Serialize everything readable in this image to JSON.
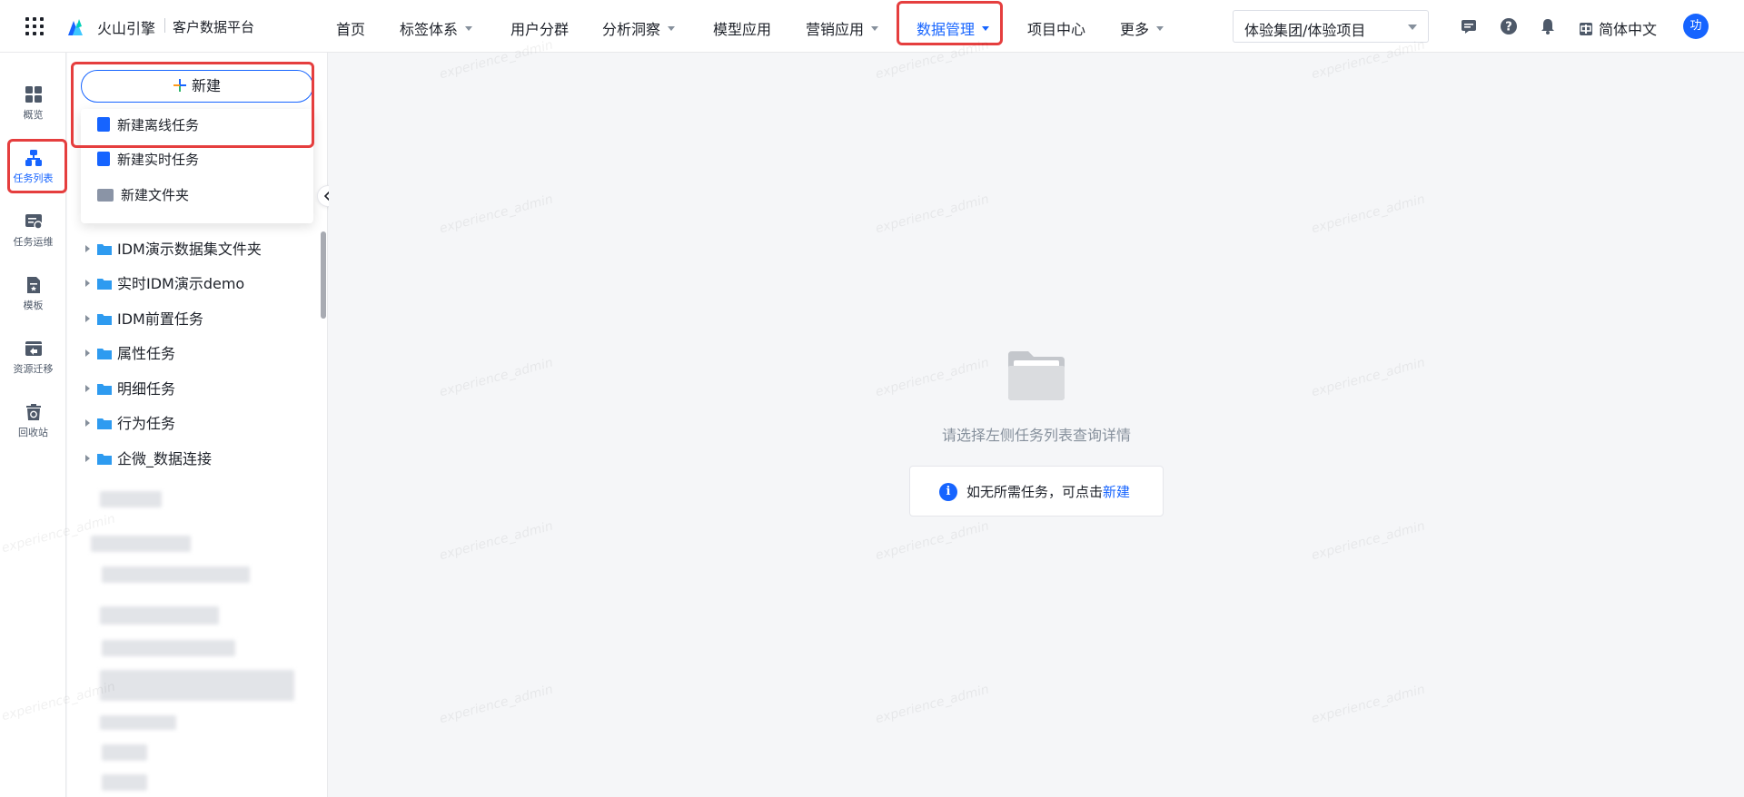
{
  "header": {
    "brand": "火山引擎",
    "platform": "客户数据平台",
    "nav": [
      {
        "label": "首页",
        "has_caret": false
      },
      {
        "label": "标签体系",
        "has_caret": true
      },
      {
        "label": "用户分群",
        "has_caret": false
      },
      {
        "label": "分析洞察",
        "has_caret": true
      },
      {
        "label": "模型应用",
        "has_caret": false
      },
      {
        "label": "营销应用",
        "has_caret": true
      },
      {
        "label": "数据管理",
        "has_caret": true,
        "active": true
      },
      {
        "label": "项目中心",
        "has_caret": false
      },
      {
        "label": "更多",
        "has_caret": true
      }
    ],
    "project_select": "体验集团/体验项目",
    "language": "简体中文",
    "avatar": "功",
    "icons": [
      "message-icon",
      "help-icon",
      "notification-icon",
      "language-icon"
    ]
  },
  "rail": {
    "items": [
      {
        "label": "概览",
        "icon": "overview-icon"
      },
      {
        "label": "任务列表",
        "icon": "task-list-icon",
        "active": true
      },
      {
        "label": "任务运维",
        "icon": "task-ops-icon"
      },
      {
        "label": "模板",
        "icon": "template-icon"
      },
      {
        "label": "资源迁移",
        "icon": "resource-migration-icon"
      },
      {
        "label": "回收站",
        "icon": "recycle-bin-icon"
      }
    ]
  },
  "panel": {
    "new_button": "新建",
    "dropdown": [
      {
        "label": "新建离线任务",
        "icon": "offline-task-icon"
      },
      {
        "label": "新建实时任务",
        "icon": "realtime-task-icon"
      },
      {
        "label": "新建文件夹",
        "icon": "folder-icon"
      }
    ],
    "tree": [
      "IDM演示数据集文件夹",
      "实时IDM演示demo",
      "IDM前置任务",
      "属性任务",
      "明细任务",
      "行为任务",
      "企微_数据连接"
    ]
  },
  "main": {
    "empty_text": "请选择左侧任务列表查询详情",
    "hint_text": "如无所需任务，可点击",
    "hint_link": "新建",
    "watermark": "experience_admin"
  },
  "colors": {
    "accent": "#1664ff",
    "highlight": "#e53e3e"
  }
}
